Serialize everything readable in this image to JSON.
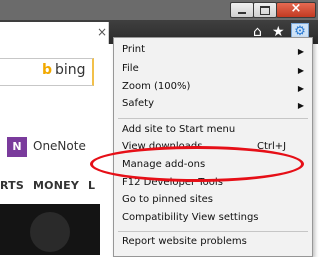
{
  "window": {
    "close_glyph": "×",
    "buttons": [
      "minimize",
      "maximize",
      "close"
    ]
  },
  "tab": {
    "close_glyph": "×"
  },
  "toolbar_icons": {
    "home": "⌂",
    "favorites": "★",
    "tools": "⚙"
  },
  "page": {
    "bing_label": "bing",
    "bing_b": "b",
    "onenote_icon": "N",
    "onenote_label": "OneNote",
    "nav_items": [
      "RTS",
      "MONEY",
      "L"
    ]
  },
  "menu": {
    "items": [
      {
        "label": "Print",
        "submenu": true
      },
      {
        "label": "File",
        "submenu": true
      },
      {
        "label": "Zoom (100%)",
        "submenu": true
      },
      {
        "label": "Safety",
        "submenu": true
      },
      {
        "label": "Add site to Start menu"
      },
      {
        "label": "View downloads",
        "shortcut": "Ctrl+J"
      },
      {
        "label": "Manage add-ons",
        "highlighted": true
      },
      {
        "label": "F12 Developer Tools"
      },
      {
        "label": "Go to pinned sites"
      },
      {
        "label": "Compatibility View settings"
      },
      {
        "label": "Report website problems"
      }
    ],
    "submenu_arrow": "▶"
  },
  "colors": {
    "highlight": "#e60f17",
    "titlebar": "#6b6b6b",
    "menu_bg": "#f2f2f2"
  }
}
